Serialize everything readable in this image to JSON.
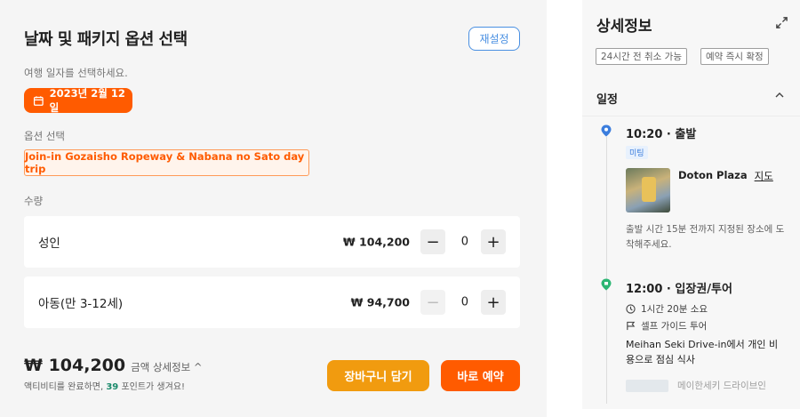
{
  "left": {
    "title": "날짜 및 패키지 옵션 선택",
    "reset_label": "재설정",
    "date_prompt": "여행 일자를 선택하세요.",
    "selected_date": "2023년 2월 12일",
    "option_label": "옵션 선택",
    "selected_option": "Join-in Gozaisho Ropeway & Nabana no Sato day trip",
    "quantity_label": "수량",
    "quantities": [
      {
        "name": "성인",
        "price": "₩ 104,200",
        "minus": "−",
        "value": "0",
        "plus": "+"
      },
      {
        "name": "아동(만 3-12세)",
        "price": "₩ 94,700",
        "minus": "−",
        "value": "0",
        "plus": "+"
      }
    ],
    "total_price": "₩ 104,200",
    "total_detail": "금액 상세정보 ^",
    "points_prefix": "액티비티를 완료하면, ",
    "points_value": "39",
    "points_suffix": " 포인트가 생겨요!",
    "cart_button": "장바구니 담기",
    "book_button": "바로 예약",
    "accent_color": "#ff5b00"
  },
  "right": {
    "title": "상세정보",
    "tags": [
      "24시간 전 취소 가능",
      "예약 즉시 확정"
    ],
    "section_title": "일정",
    "stop1": {
      "time_title": "10:20 · 출발",
      "badge": "미팅",
      "place": "Doton Plaza",
      "map_link": "지도",
      "note": "출발 시간 15분 전까지 지정된 장소에 도착해주세요."
    },
    "stop2": {
      "time_title": "12:00 · 입장권/투어",
      "duration": "1시간 20분 소요",
      "guide": "셀프 가이드 투어",
      "desc": "Meihan Seki Drive-in에서 개인 비용으로 점심 식사",
      "next_preview": "메이한세키 드라이브인"
    },
    "pin_blue": "#3b7ddd",
    "pin_green": "#2bb673"
  }
}
